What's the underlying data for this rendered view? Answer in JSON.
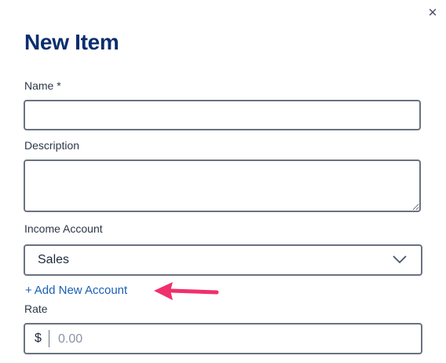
{
  "dialog": {
    "title": "New Item",
    "close_icon": "close-icon"
  },
  "form": {
    "name_label": "Name *",
    "name_value": "",
    "description_label": "Description",
    "description_value": "",
    "income_account_label": "Income Account",
    "income_account_selected": "Sales",
    "add_account_link": "Add New Account",
    "add_account_icon": "plus-icon",
    "rate_label": "Rate",
    "rate_prefix": "$",
    "rate_placeholder": "0.00"
  },
  "annotation": {
    "arrow_color": "#f0306b"
  },
  "colors": {
    "title": "#0b2e6f",
    "link": "#1a5fb4",
    "border": "#6b7280"
  }
}
